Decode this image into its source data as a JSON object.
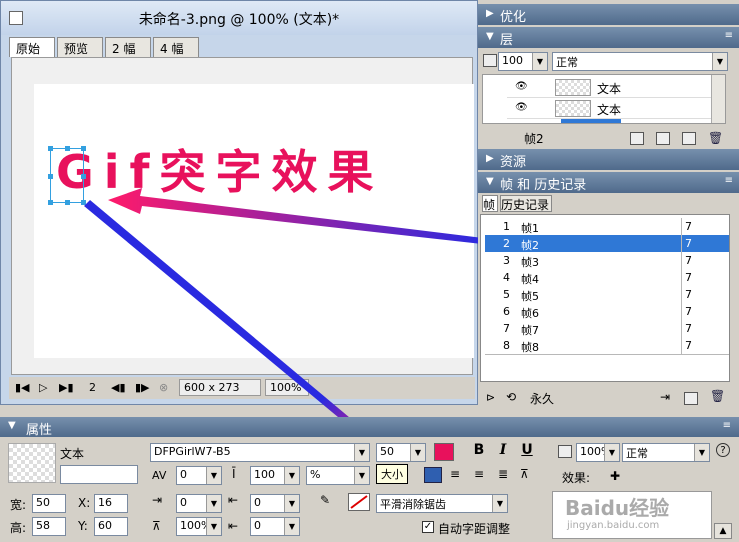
{
  "document": {
    "title": "未命名-3.png @  100% (文本)*",
    "tabs": [
      "原始",
      "预览",
      "2 幅",
      "4 幅"
    ],
    "active_tab": "原始",
    "canvas_text": "Gif突字效果",
    "status": {
      "frame": "2",
      "size": "600 x 273",
      "zoom": "100%"
    }
  },
  "panels": {
    "optimize": {
      "title": "优化"
    },
    "layers": {
      "title": "层",
      "opacity": "100",
      "blend": "正常",
      "items": [
        "文本",
        "文本"
      ],
      "footer_label": "帧2"
    },
    "resources": {
      "title": "资源"
    },
    "frames": {
      "title": "帧 和 历史记录",
      "tabs": [
        "帧",
        "历史记录"
      ],
      "rows": [
        {
          "n": "1",
          "name": "帧1",
          "delay": "7"
        },
        {
          "n": "2",
          "name": "帧2",
          "delay": "7"
        },
        {
          "n": "3",
          "name": "帧3",
          "delay": "7"
        },
        {
          "n": "4",
          "name": "帧4",
          "delay": "7"
        },
        {
          "n": "5",
          "name": "帧5",
          "delay": "7"
        },
        {
          "n": "6",
          "name": "帧6",
          "delay": "7"
        },
        {
          "n": "7",
          "name": "帧7",
          "delay": "7"
        },
        {
          "n": "8",
          "name": "帧8",
          "delay": "7"
        }
      ],
      "selected_index": 1,
      "loop_label": "永久"
    }
  },
  "properties": {
    "title": "属性",
    "object_type": "文本",
    "font": "DFPGirlW7-B5",
    "font_size": "50",
    "tooltip": "大小",
    "kerning": "0",
    "leading": "100",
    "leading_unit": "%",
    "baseline": "0",
    "indent": "0",
    "horizontal_scale": "100%",
    "space_after": "0",
    "antialias": "平滑消除锯齿",
    "auto_kern": "自动字距调整",
    "width_label": "宽:",
    "width": "50",
    "height_label": "高:",
    "height": "58",
    "x_label": "X:",
    "x": "16",
    "y_label": "Y:",
    "y": "60",
    "opacity": "100%",
    "blend": "正常",
    "effects_label": "效果:",
    "text_color": "#e8115c",
    "watermark": "Baidu经验",
    "watermark_url": "jingyan.baidu.com"
  }
}
